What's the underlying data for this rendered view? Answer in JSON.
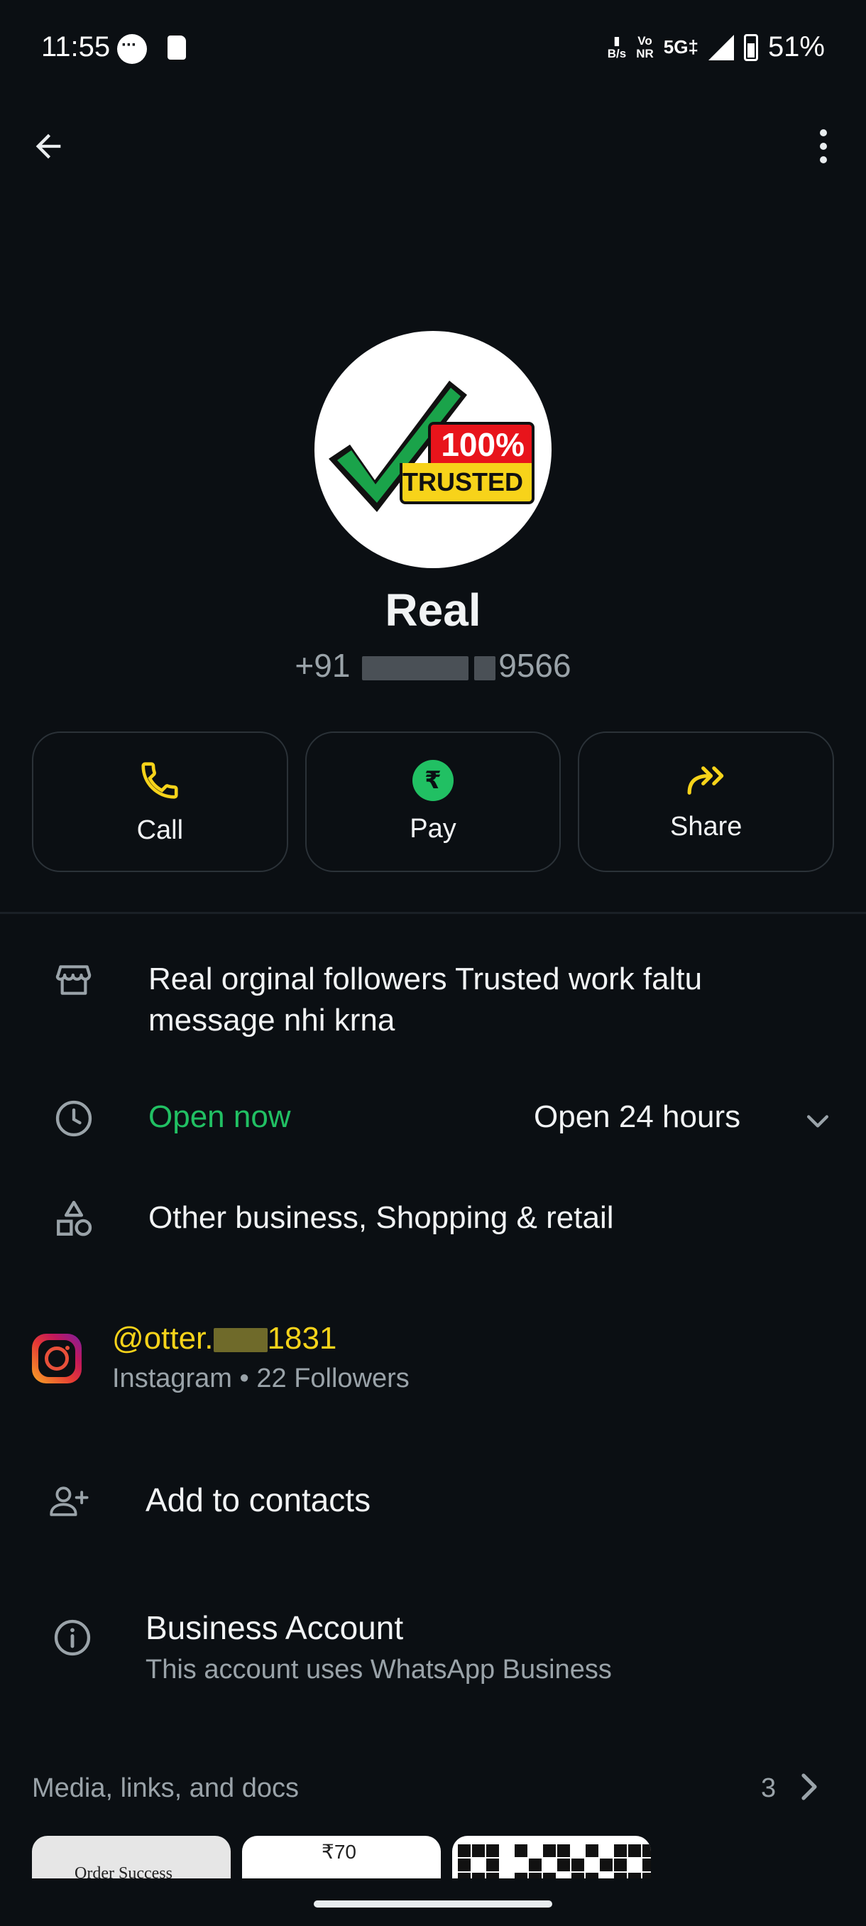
{
  "status_bar": {
    "time": "11:55",
    "net_speed": "B/s",
    "volte_top": "Vo",
    "volte_bottom": "NR",
    "network": "5G‡",
    "battery": "51%"
  },
  "header": {
    "back_icon": "arrow-left-icon",
    "menu_icon": "more-vertical-icon"
  },
  "profile": {
    "name": "Real",
    "phone_prefix": "+91",
    "phone_suffix": "9566",
    "avatar_badge_top": "100%",
    "avatar_badge_bottom": "TRUSTED"
  },
  "actions": [
    {
      "label": "Call",
      "icon": "phone-icon"
    },
    {
      "label": "Pay",
      "icon": "rupee-icon",
      "icon_text": "₹"
    },
    {
      "label": "Share",
      "icon": "share-forward-icon"
    }
  ],
  "business": {
    "description": "Real orginal followers Trusted work faltu message nhi krna",
    "open_status": "Open now",
    "hours": "Open 24 hours",
    "category": "Other business, Shopping & retail"
  },
  "instagram": {
    "handle_prefix": "@otter.",
    "handle_suffix": "1831",
    "meta": "Instagram • 22 Followers"
  },
  "add_contacts": {
    "label": "Add to contacts"
  },
  "business_account": {
    "title": "Business Account",
    "subtitle": "This account uses WhatsApp Business"
  },
  "media": {
    "title": "Media, links, and docs",
    "count": "3",
    "thumb1_text": "Order Success",
    "thumb2_text": "₹70"
  },
  "colors": {
    "background": "#0b0f13",
    "accent_yellow": "#f7d31a",
    "accent_green": "#21c063",
    "secondary_text": "#9aa3a9"
  }
}
